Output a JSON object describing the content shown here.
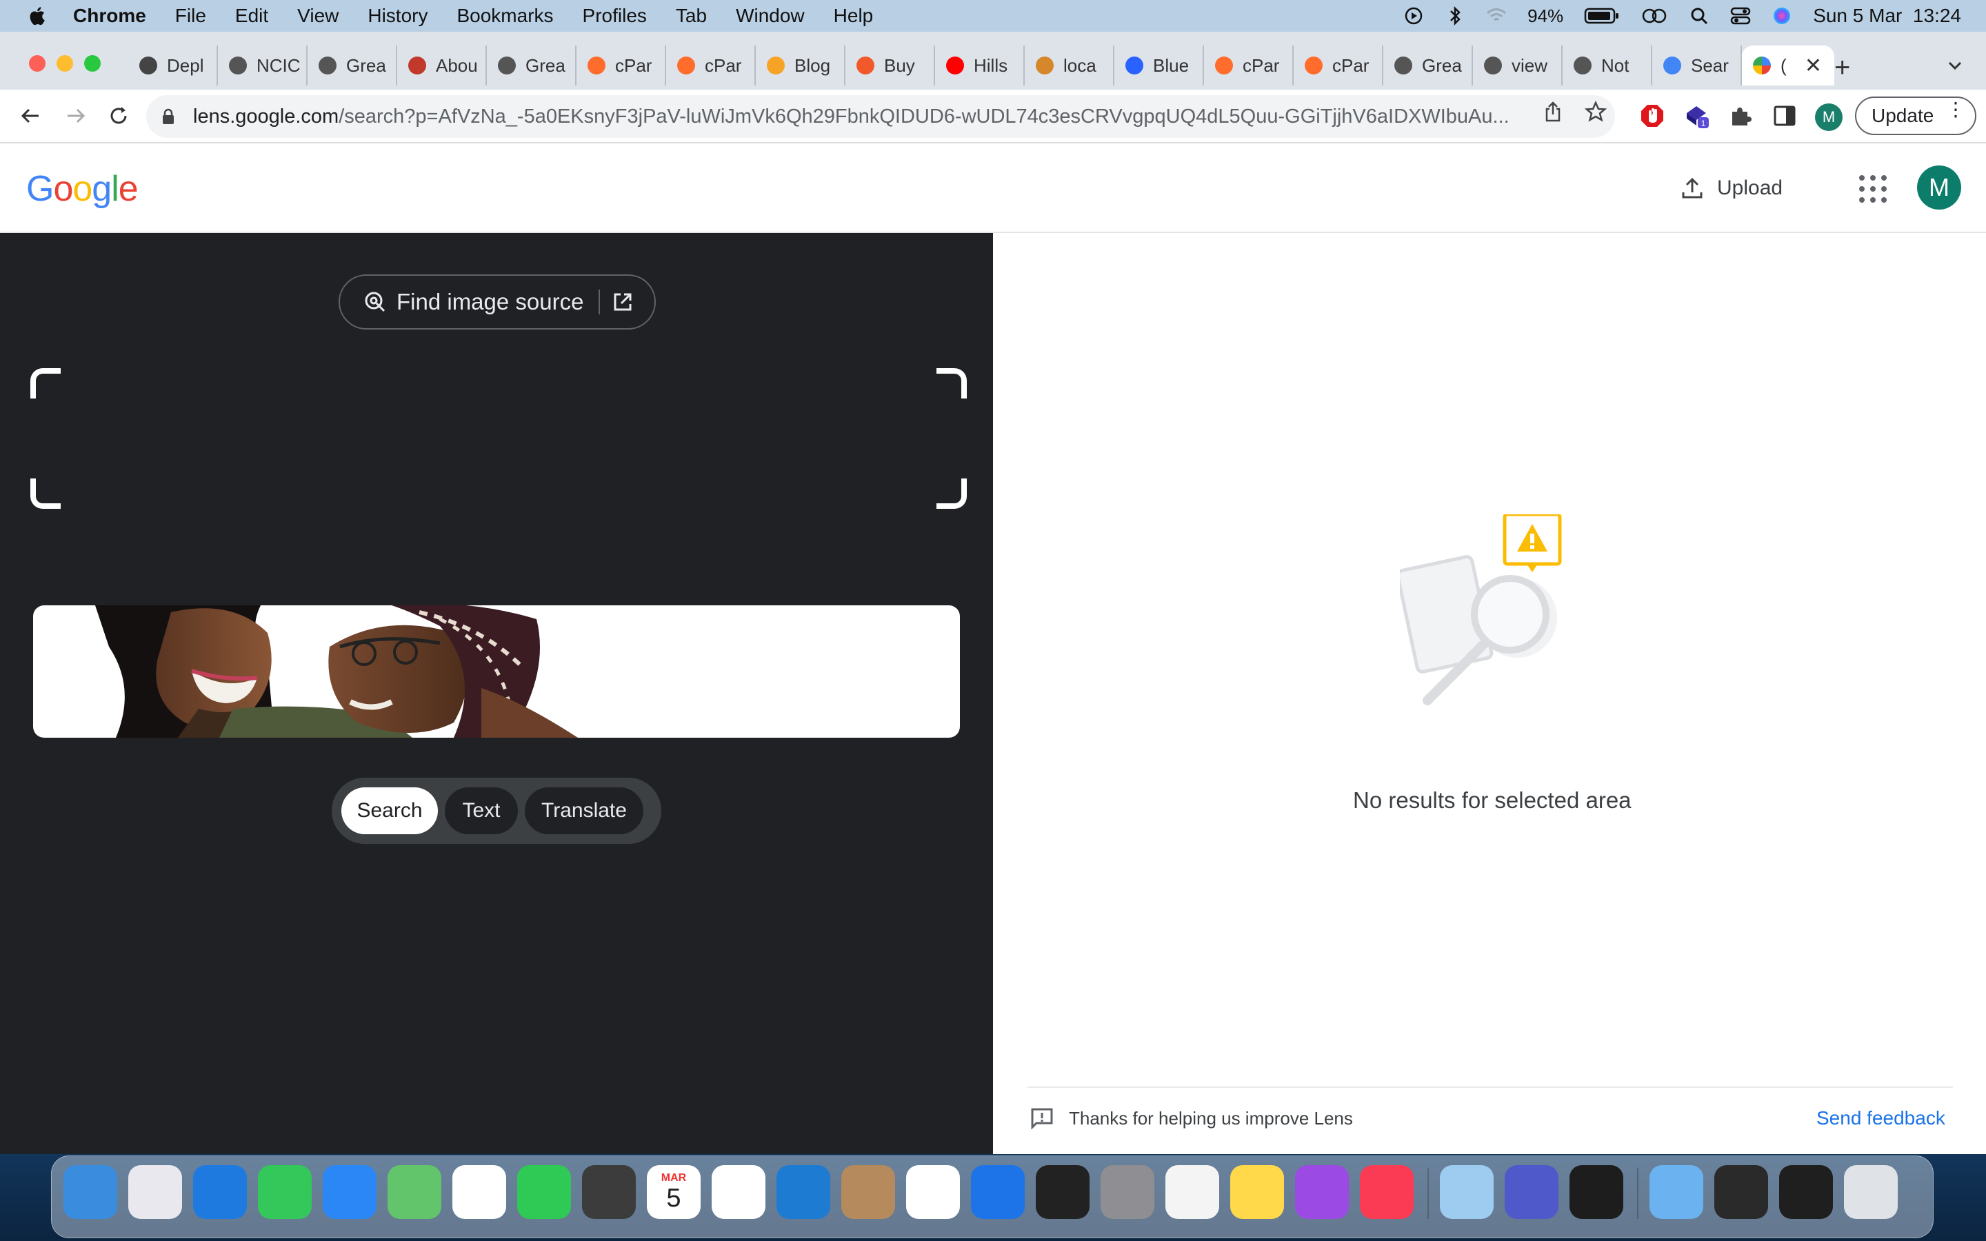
{
  "menubar": {
    "app": "Chrome",
    "items": [
      "File",
      "Edit",
      "View",
      "History",
      "Bookmarks",
      "Profiles",
      "Tab",
      "Window",
      "Help"
    ],
    "battery": "94%",
    "datetime": "Sun 5 Mar  13:24"
  },
  "tabs": [
    {
      "label": "Depl",
      "icon": "chatgpt-icon",
      "color": "#444"
    },
    {
      "label": "NCIC",
      "icon": "globe-icon",
      "color": "#555"
    },
    {
      "label": "Grea",
      "icon": "globe-icon",
      "color": "#555"
    },
    {
      "label": "Abou",
      "icon": "dots-icon",
      "color": "#c0392b"
    },
    {
      "label": "Grea",
      "icon": "globe-icon",
      "color": "#555"
    },
    {
      "label": "cPar",
      "icon": "cpanel-icon",
      "color": "#ff6c2c"
    },
    {
      "label": "cPar",
      "icon": "cpanel-icon",
      "color": "#ff6c2c"
    },
    {
      "label": "Blog",
      "icon": "blog-icon",
      "color": "#f7a325"
    },
    {
      "label": "Buy",
      "icon": "buy-icon",
      "color": "#f1592a"
    },
    {
      "label": "Hills",
      "icon": "youtube-icon",
      "color": "#ff0000"
    },
    {
      "label": "loca",
      "icon": "pma-icon",
      "color": "#d6862b"
    },
    {
      "label": "Blue",
      "icon": "grid-icon",
      "color": "#2962ff"
    },
    {
      "label": "cPar",
      "icon": "cpanel-icon",
      "color": "#ff6c2c"
    },
    {
      "label": "cPar",
      "icon": "cpanel-icon",
      "color": "#ff6c2c"
    },
    {
      "label": "Grea",
      "icon": "globe-icon",
      "color": "#555"
    },
    {
      "label": "view",
      "icon": "globe-icon",
      "color": "#555"
    },
    {
      "label": "Not",
      "icon": "globe-icon",
      "color": "#555"
    },
    {
      "label": "Sear",
      "icon": "google-icon",
      "color": "#4285f4"
    }
  ],
  "active_tab": {
    "label": "(",
    "icon": "lens-icon"
  },
  "address": {
    "domain": "lens.google.com",
    "path": "/search?p=AfVzNa_-5a0EKsnyF3jPaV-luWiJmVk6Qh29FbnkQIDUD6-wUDL74c3esCRVvgpqUQ4dL5Quu-GGiTjjhV6aIDXWIbuAu..."
  },
  "profile_initial": "M",
  "update_label": "Update",
  "google": {
    "logo": "Google",
    "upload_label": "Upload",
    "avatar_initial": "M"
  },
  "lens": {
    "find_source_label": "Find image source",
    "modes": [
      {
        "label": "Search",
        "active": true
      },
      {
        "label": "Text",
        "active": false
      },
      {
        "label": "Translate",
        "active": false
      }
    ],
    "no_results": "No results for selected area",
    "thanks": "Thanks for helping us improve Lens",
    "send_feedback": "Send feedback"
  },
  "dock": {
    "calendar_month": "MAR",
    "calendar_day": "5",
    "apps": [
      "finder",
      "launchpad",
      "safari",
      "messages",
      "mail",
      "maps",
      "photos",
      "facetime",
      "sublime",
      "calendar",
      "chrome",
      "vscode",
      "contacts",
      "reminders",
      "xcode",
      "terminal",
      "system-settings",
      "textedit",
      "notes",
      "podcasts",
      "music",
      "preview",
      "teams",
      "activity-monitor",
      "downloads",
      "window-1",
      "window-2",
      "trash"
    ]
  },
  "colors": {
    "accent_blue": "#1a73e8",
    "lens_dark": "#202124",
    "warning_yellow": "#fbbc04"
  }
}
